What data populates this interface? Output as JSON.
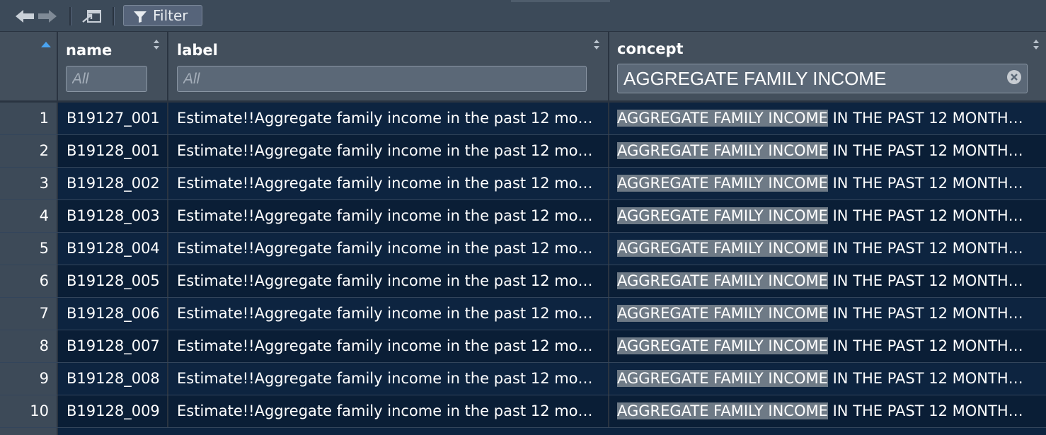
{
  "toolbar": {
    "filter_label": "Filter",
    "icons": [
      "back-arrow-icon",
      "forward-arrow-icon",
      "popout-icon",
      "filter-funnel-icon"
    ]
  },
  "columns": {
    "name": {
      "title": "name",
      "filter_placeholder": "All"
    },
    "label": {
      "title": "label",
      "filter_placeholder": "All"
    },
    "concept": {
      "title": "concept",
      "filter_value": "AGGREGATE FAMILY INCOME"
    }
  },
  "rows": [
    {
      "index": "1",
      "name": "B19127_001",
      "label": "Estimate!!Aggregate family income in the past 12 mo…",
      "concept_match": "AGGREGATE FAMILY INCOME",
      "concept_rest": " IN THE PAST 12 MONTH…"
    },
    {
      "index": "2",
      "name": "B19128_001",
      "label": "Estimate!!Aggregate family income in the past 12 mo…",
      "concept_match": "AGGREGATE FAMILY INCOME",
      "concept_rest": " IN THE PAST 12 MONTH…"
    },
    {
      "index": "3",
      "name": "B19128_002",
      "label": "Estimate!!Aggregate family income in the past 12 mo…",
      "concept_match": "AGGREGATE FAMILY INCOME",
      "concept_rest": " IN THE PAST 12 MONTH…"
    },
    {
      "index": "4",
      "name": "B19128_003",
      "label": "Estimate!!Aggregate family income in the past 12 mo…",
      "concept_match": "AGGREGATE FAMILY INCOME",
      "concept_rest": " IN THE PAST 12 MONTH…"
    },
    {
      "index": "5",
      "name": "B19128_004",
      "label": "Estimate!!Aggregate family income in the past 12 mo…",
      "concept_match": "AGGREGATE FAMILY INCOME",
      "concept_rest": " IN THE PAST 12 MONTH…"
    },
    {
      "index": "6",
      "name": "B19128_005",
      "label": "Estimate!!Aggregate family income in the past 12 mo…",
      "concept_match": "AGGREGATE FAMILY INCOME",
      "concept_rest": " IN THE PAST 12 MONTH…"
    },
    {
      "index": "7",
      "name": "B19128_006",
      "label": "Estimate!!Aggregate family income in the past 12 mo…",
      "concept_match": "AGGREGATE FAMILY INCOME",
      "concept_rest": " IN THE PAST 12 MONTH…"
    },
    {
      "index": "8",
      "name": "B19128_007",
      "label": "Estimate!!Aggregate family income in the past 12 mo…",
      "concept_match": "AGGREGATE FAMILY INCOME",
      "concept_rest": " IN THE PAST 12 MONTH…"
    },
    {
      "index": "9",
      "name": "B19128_008",
      "label": "Estimate!!Aggregate family income in the past 12 mo…",
      "concept_match": "AGGREGATE FAMILY INCOME",
      "concept_rest": " IN THE PAST 12 MONTH…"
    },
    {
      "index": "10",
      "name": "B19128_009",
      "label": "Estimate!!Aggregate family income in the past 12 mo…",
      "concept_match": "AGGREGATE FAMILY INCOME",
      "concept_rest": " IN THE PAST 12 MONTH…"
    }
  ],
  "colors": {
    "background": "#0d2440",
    "header": "#434f5c",
    "toolbar": "#3c4a59",
    "highlight": "#6e7a86",
    "sort_active": "#4aa3f0"
  }
}
